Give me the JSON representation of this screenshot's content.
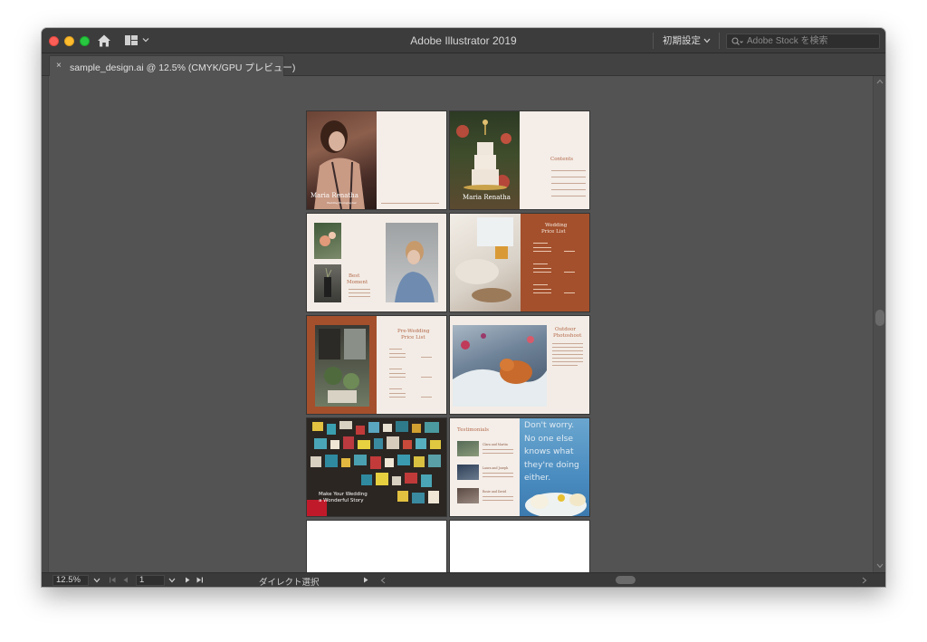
{
  "app": {
    "title": "Adobe Illustrator 2019",
    "workspace": "初期設定",
    "stock_search_placeholder": "Adobe Stock を検索"
  },
  "document_tab": {
    "close_glyph": "×",
    "label": "sample_design.ai @ 12.5% (CMYK/GPU プレビュー)"
  },
  "artboards": {
    "p1": {
      "cover_title": "Maria Renatha",
      "cover_subtitle": "Wedding Photographer"
    },
    "p2": {
      "cover_title": "Maria Renatha",
      "contents_title": "Contents"
    },
    "p3": {
      "title_line1": "Best",
      "title_line2": "Moment"
    },
    "p4": {
      "title_line1": "Wedding",
      "title_line2": "Price List"
    },
    "p5": {
      "title_line1": "Pre-Wedding",
      "title_line2": "Price List"
    },
    "p6": {
      "title_line1": "Outdoor",
      "title_line2": "Photoshoot"
    },
    "p7": {
      "title_line1": "Make Your Wedding",
      "title_line2": "a Wonderful Story"
    },
    "p8": {
      "title": "Testimonials",
      "quote": [
        "Don't worry.",
        "No one else",
        "knows what",
        "they're doing",
        "either."
      ],
      "names": [
        "Clara and Martin",
        "Laura and Joseph",
        "Rosie and David"
      ]
    }
  },
  "status": {
    "zoom": "12.5%",
    "page": "1",
    "tool": "ダイレクト選択"
  },
  "colors": {
    "accent": "#b36a4a",
    "rust_panel": "#a4502c",
    "chrome_dark": "#3c3c3c",
    "canvas": "#535353"
  }
}
